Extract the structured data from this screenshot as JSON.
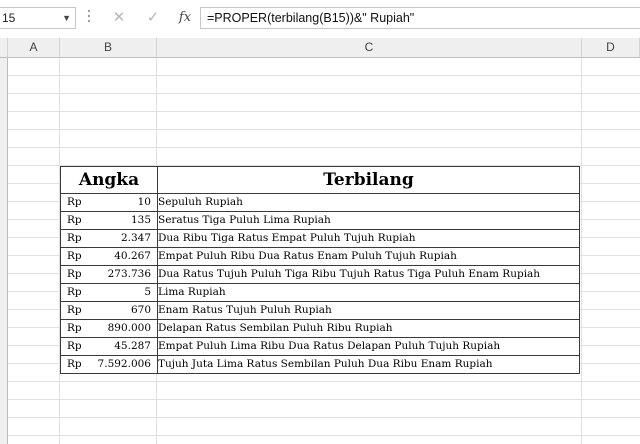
{
  "formula_bar": {
    "name_box": "15",
    "cancel_glyph": "✕",
    "enter_glyph": "✓",
    "fx_label": "fx",
    "formula": "=PROPER(terbilang(B15))&\" Rupiah\""
  },
  "columns": [
    "A",
    "B",
    "C",
    "D"
  ],
  "table": {
    "header_angka": "Angka",
    "header_terbilang": "Terbilang",
    "rows": [
      {
        "currency": "Rp",
        "amount": "10",
        "text": "Sepuluh Rupiah"
      },
      {
        "currency": "Rp",
        "amount": "135",
        "text": "Seratus Tiga Puluh Lima Rupiah"
      },
      {
        "currency": "Rp",
        "amount": "2.347",
        "text": "Dua Ribu Tiga Ratus Empat Puluh Tujuh Rupiah"
      },
      {
        "currency": "Rp",
        "amount": "40.267",
        "text": "Empat Puluh Ribu Dua Ratus Enam Puluh Tujuh Rupiah"
      },
      {
        "currency": "Rp",
        "amount": "273.736",
        "text": "Dua Ratus Tujuh Puluh Tiga Ribu Tujuh Ratus Tiga Puluh Enam Rupiah"
      },
      {
        "currency": "Rp",
        "amount": "5",
        "text": "Lima Rupiah"
      },
      {
        "currency": "Rp",
        "amount": "670",
        "text": "Enam Ratus Tujuh Puluh Rupiah"
      },
      {
        "currency": "Rp",
        "amount": "890.000",
        "text": "Delapan Ratus Sembilan Puluh Ribu Rupiah"
      },
      {
        "currency": "Rp",
        "amount": "45.287",
        "text": "Empat Puluh Lima Ribu Dua Ratus Delapan Puluh Tujuh Rupiah"
      },
      {
        "currency": "Rp",
        "amount": "7.592.006",
        "text": "Tujuh Juta Lima Ratus Sembilan Puluh Dua Ribu Enam Rupiah"
      }
    ]
  }
}
